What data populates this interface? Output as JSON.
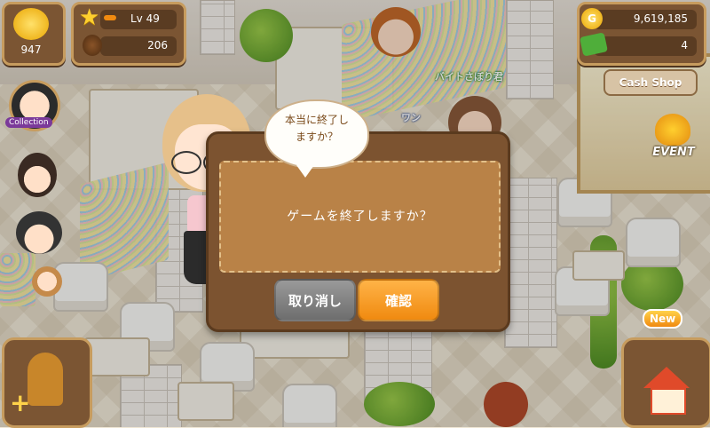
{
  "hud": {
    "status_face_value": "947",
    "level_label": "Lv 49",
    "coffee_beans": "206",
    "gold": "9,619,185",
    "cash": "4",
    "cash_shop_label": "Cash Shop"
  },
  "side": {
    "collection_label": "Collection",
    "event_label": "EVENT",
    "new_badge": "New"
  },
  "scene": {
    "npc_name": "バイトさぼり君",
    "npc_name_partial": "ワン"
  },
  "dialog": {
    "speech_bubble_text": "本当に終了しますか？",
    "message": "ゲームを終了しますか？",
    "cancel_label": "取り消し",
    "confirm_label": "確認"
  },
  "colors": {
    "panel_brown": "#7b5533",
    "panel_border": "#c79c5e",
    "confirm_orange": "#f08a10",
    "cancel_gray": "#7e7e7e"
  }
}
